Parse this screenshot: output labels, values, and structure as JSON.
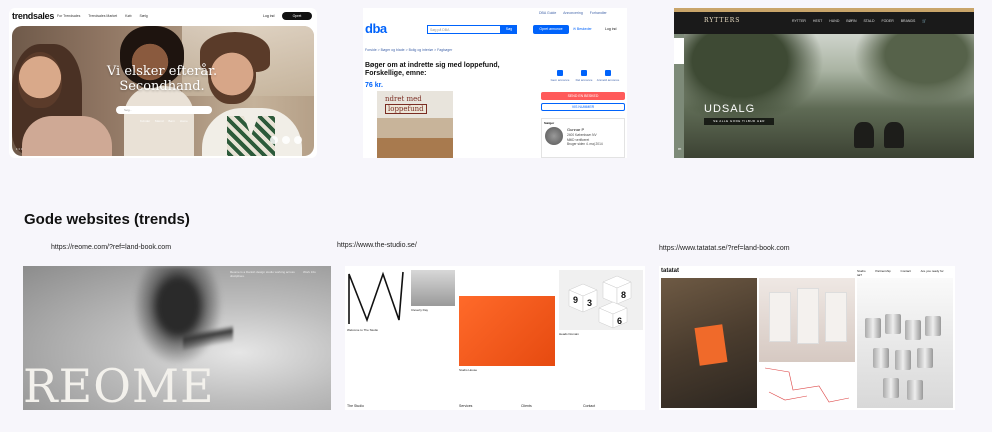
{
  "section": {
    "heading": "Gode websites (trends)"
  },
  "trendsales": {
    "logo": "trendsales",
    "nav": [
      "For Trendsales",
      "Trendsales Market",
      "Køb",
      "Sælg"
    ],
    "login": "Log ind",
    "cta": "Opret",
    "headline": "Vi elsker efterår. Secondhand.",
    "search_placeholder": "Søg...",
    "chips": [
      "Kvinder",
      "Mænd",
      "Børn",
      "Home"
    ]
  },
  "dba": {
    "top_links": [
      "DBA Guide",
      "Annoncering",
      "Forhandler"
    ],
    "logo": "dba",
    "search_placeholder": "Søg på DBA",
    "search_button": "Søg",
    "create_ad": "Opret annonce",
    "messages": "Beskeder",
    "login": "Log ind",
    "breadcrumbs": "Forside > Bøger og blade > Bolig og interiør > Fagbøger",
    "title": "Bøger om at indrette sig med loppefund, Forskellige, emne:",
    "price": "76 kr.",
    "book_text_1": "ndret med",
    "book_text_2": "loppefund",
    "actions": [
      "Gem annonce",
      "Del annonce",
      "Anmeld annonce"
    ],
    "buy_button": "SEND EN BESKED",
    "mobilepay_button": "VIS NUMMER",
    "seller_label": "Sælger",
    "seller_name": "Gunnar P",
    "seller_info": [
      "2400 København NV",
      "MitID verificeret",
      "Bruger siden 4. maj 2014"
    ]
  },
  "rytters": {
    "brand": "RYTTERS",
    "nav": [
      "RYTTER",
      "HEST",
      "HUND",
      "BØRN",
      "STALD",
      "FODER",
      "BRANDS"
    ],
    "sale_title": "UDSALG",
    "sale_button": "SE ALLE GODE TILBUD HER",
    "corner": "m"
  },
  "urls": {
    "reome": "https://reome.com/?ref=land-book.com",
    "studio": "https://www.the-studio.se/",
    "tatatat": "https://www.tatatat.se/?ref=land-book.com"
  },
  "reome": {
    "wordmark": "REOME",
    "tagline": "Reome is a Danish design studio working across disciplines.",
    "nav": "Work Info"
  },
  "studio": {
    "captions": [
      "Welcome to The Studio",
      "Cleverly Day",
      "Studio House",
      "Heads Domain"
    ],
    "footer": [
      "The Studio",
      "Services",
      "Clients",
      "Contact"
    ]
  },
  "tatatat": {
    "logo": "tatatat",
    "nav": [
      "Studio",
      "Partnership",
      "Contact",
      "Are you ready for tat?"
    ]
  }
}
